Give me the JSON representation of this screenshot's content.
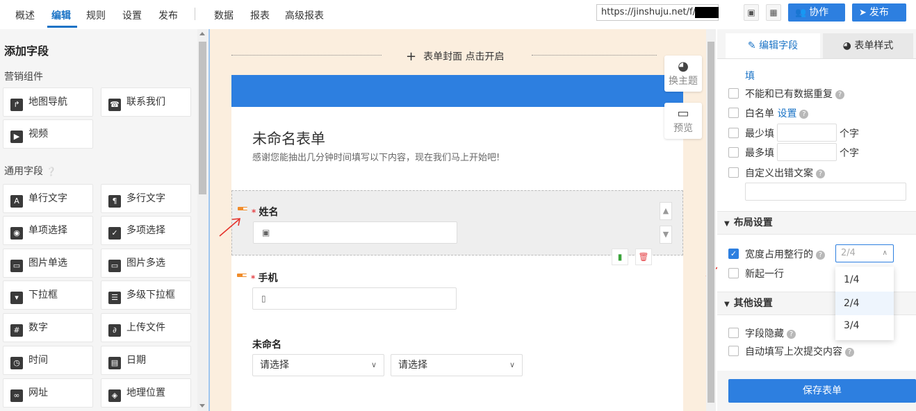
{
  "nav": {
    "tabs": [
      "概述",
      "编辑",
      "规则",
      "设置",
      "发布"
    ],
    "tabs2": [
      "数据",
      "报表",
      "高级报表"
    ],
    "active": "编辑"
  },
  "toolbar": {
    "url": "https://jinshuju.net/f/Fo",
    "collab_label": "协作",
    "publish_label": "发布"
  },
  "left": {
    "title": "添加字段",
    "marketing_label": "营销组件",
    "marketing_items": [
      "地图导航",
      "联系我们",
      "视频"
    ],
    "general_label": "通用字段",
    "general_items": [
      "单行文字",
      "多行文字",
      "单项选择",
      "多项选择",
      "图片单选",
      "图片多选",
      "下拉框",
      "多级下拉框",
      "数字",
      "上传文件",
      "时间",
      "日期",
      "网址",
      "地理位置"
    ]
  },
  "canvas": {
    "cover_text": "表单封面 点击开启",
    "theme_label": "换主题",
    "preview_label": "预览",
    "form_title": "未命名表单",
    "form_desc": "感谢您能抽出几分钟时间填写以下内容，现在我们马上开始吧!",
    "fields": [
      {
        "label": "姓名",
        "required": true
      },
      {
        "label": "手机",
        "required": true
      },
      {
        "label": "未命名",
        "required": false
      }
    ],
    "select_placeholder": "请选择"
  },
  "right": {
    "tab_edit": "编辑字段",
    "tab_style": "表单样式",
    "fill_label": "填",
    "no_dup": "不能和已有数据重复",
    "whitelist": "白名单",
    "whitelist_link": "设置",
    "min_fill": "最少填",
    "max_fill": "最多填",
    "unit": "个字",
    "custom_error": "自定义出错文案",
    "layout_section": "布局设置",
    "width_label": "宽度占用整行的",
    "width_value": "2/4",
    "new_line": "新起一行",
    "other_section": "其他设置",
    "hide_field": "字段隐藏",
    "autofill": "自动填写上次提交内容",
    "width_options": [
      "1/4",
      "2/4",
      "3/4"
    ],
    "save_label": "保存表单"
  },
  "colors": {
    "accent": "#2d7fe0",
    "canvas_bg": "#fbeede",
    "required": "#e5464a",
    "drag": "#f08c2a"
  }
}
